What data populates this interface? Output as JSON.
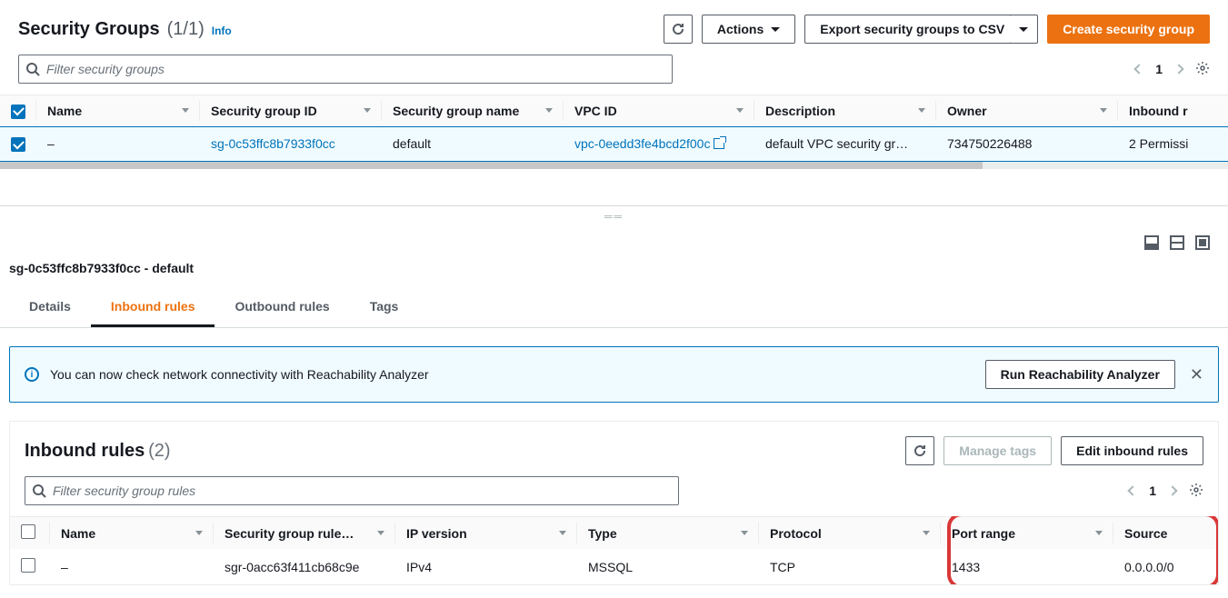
{
  "header": {
    "title": "Security Groups",
    "count": "(1/1)",
    "info": "Info"
  },
  "buttons": {
    "actions": "Actions",
    "export": "Export security groups to CSV",
    "create": "Create security group",
    "run_reachability": "Run Reachability Analyzer",
    "manage_tags": "Manage tags",
    "edit_inbound": "Edit inbound rules"
  },
  "search": {
    "placeholder_main": "Filter security groups",
    "placeholder_rules": "Filter security group rules"
  },
  "pager": {
    "page_main": "1",
    "page_rules": "1"
  },
  "table_main": {
    "headers": {
      "name": "Name",
      "sg_id": "Security group ID",
      "sg_name": "Security group name",
      "vpc_id": "VPC ID",
      "description": "Description",
      "owner": "Owner",
      "inbound": "Inbound r"
    },
    "row": {
      "name": "–",
      "sg_id": "sg-0c53ffc8b7933f0cc",
      "sg_name": "default",
      "vpc_id": "vpc-0eedd3fe4bcd2f00c",
      "description": "default VPC security gr…",
      "owner": "734750226488",
      "inbound": "2 Permissi"
    }
  },
  "detail": {
    "title": "sg-0c53ffc8b7933f0cc - default",
    "tabs": {
      "details": "Details",
      "inbound": "Inbound rules",
      "outbound": "Outbound rules",
      "tags": "Tags"
    },
    "alert": "You can now check network connectivity with Reachability Analyzer",
    "inner_title": "Inbound rules",
    "inner_count": "(2)"
  },
  "table_rules": {
    "headers": {
      "name": "Name",
      "rule_id": "Security group rule…",
      "ip_version": "IP version",
      "type": "Type",
      "protocol": "Protocol",
      "port_range": "Port range",
      "source": "Source"
    },
    "row": {
      "name": "–",
      "rule_id": "sgr-0acc63f411cb68c9e",
      "ip_version": "IPv4",
      "type": "MSSQL",
      "protocol": "TCP",
      "port_range": "1433",
      "source": "0.0.0.0/0"
    }
  }
}
